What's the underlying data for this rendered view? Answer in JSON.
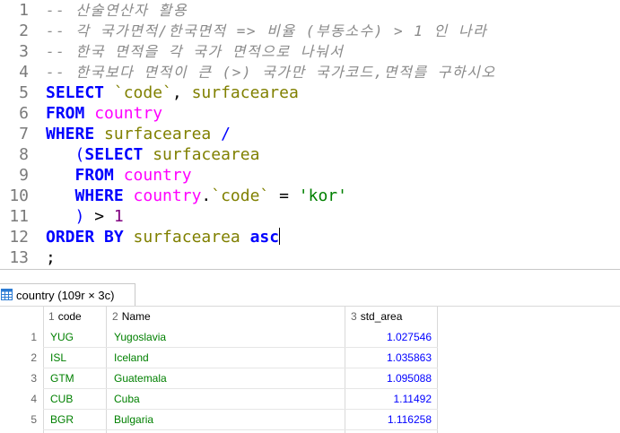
{
  "editor": {
    "lines": [
      {
        "n": "1",
        "tokens": [
          {
            "c": "cmt",
            "t": "-- 산술연산자 활용"
          }
        ]
      },
      {
        "n": "2",
        "tokens": [
          {
            "c": "cmt",
            "t": "-- 각 국가면적/한국면적 => 비율 (부동소수) > 1 인 나라"
          }
        ]
      },
      {
        "n": "3",
        "tokens": [
          {
            "c": "cmt",
            "t": "-- 한국 면적을 각 국가 면적으로 나눠서"
          }
        ]
      },
      {
        "n": "4",
        "tokens": [
          {
            "c": "cmt",
            "t": "-- 한국보다 면적이 큰 (>) 국가만 국가코드,면적를 구하시오"
          }
        ]
      },
      {
        "n": "5",
        "tokens": [
          {
            "c": "kw",
            "t": "SELECT "
          },
          {
            "c": "fld",
            "t": "`code`"
          },
          {
            "c": "pl",
            "t": ", "
          },
          {
            "c": "fld",
            "t": "surfacearea"
          }
        ]
      },
      {
        "n": "6",
        "tokens": [
          {
            "c": "kw",
            "t": "FROM "
          },
          {
            "c": "tbl",
            "t": "country"
          }
        ]
      },
      {
        "n": "7",
        "tokens": [
          {
            "c": "kw",
            "t": "WHERE "
          },
          {
            "c": "fld",
            "t": "surfacearea "
          },
          {
            "c": "op",
            "t": "/"
          }
        ]
      },
      {
        "n": "8",
        "tokens": [
          {
            "c": "pl",
            "t": "   "
          },
          {
            "c": "op",
            "t": "("
          },
          {
            "c": "kw",
            "t": "SELECT "
          },
          {
            "c": "fld",
            "t": "surfacearea"
          }
        ]
      },
      {
        "n": "9",
        "tokens": [
          {
            "c": "pl",
            "t": "   "
          },
          {
            "c": "kw",
            "t": "FROM "
          },
          {
            "c": "tbl",
            "t": "country"
          }
        ]
      },
      {
        "n": "10",
        "tokens": [
          {
            "c": "pl",
            "t": "   "
          },
          {
            "c": "kw",
            "t": "WHERE "
          },
          {
            "c": "tbl",
            "t": "country"
          },
          {
            "c": "pl",
            "t": "."
          },
          {
            "c": "fld",
            "t": "`code`"
          },
          {
            "c": "pl",
            "t": " = "
          },
          {
            "c": "str",
            "t": "'kor'"
          }
        ]
      },
      {
        "n": "11",
        "tokens": [
          {
            "c": "pl",
            "t": "   "
          },
          {
            "c": "op",
            "t": ")"
          },
          {
            "c": "pl",
            "t": " > "
          },
          {
            "c": "num",
            "t": "1"
          }
        ]
      },
      {
        "n": "12",
        "tokens": [
          {
            "c": "kw",
            "t": "ORDER BY "
          },
          {
            "c": "fld",
            "t": "surfacearea "
          },
          {
            "c": "kw",
            "t": "asc"
          }
        ],
        "caret": true
      },
      {
        "n": "13",
        "tokens": [
          {
            "c": "pl",
            "t": ";"
          }
        ]
      }
    ]
  },
  "result_tab": {
    "label": "country (109r × 3c)",
    "icon": "table-grid-icon"
  },
  "grid": {
    "columns": [
      {
        "idx": "1",
        "name": "code"
      },
      {
        "idx": "2",
        "name": "Name"
      },
      {
        "idx": "3",
        "name": "std_area"
      }
    ],
    "rows": [
      {
        "rn": "1",
        "code": "YUG",
        "name": "Yugoslavia",
        "std_area": "1.027546"
      },
      {
        "rn": "2",
        "code": "ISL",
        "name": "Iceland",
        "std_area": "1.035863"
      },
      {
        "rn": "3",
        "code": "GTM",
        "name": "Guatemala",
        "std_area": "1.095088"
      },
      {
        "rn": "4",
        "code": "CUB",
        "name": "Cuba",
        "std_area": "1.11492"
      },
      {
        "rn": "5",
        "code": "BGR",
        "name": "Bulgaria",
        "std_area": "1.116258"
      }
    ]
  },
  "colors": {
    "keyword": "#0000ff",
    "field": "#808000",
    "table": "#ff00ff",
    "string": "#008000",
    "number": "#800080",
    "comment": "#8a8a8a"
  }
}
